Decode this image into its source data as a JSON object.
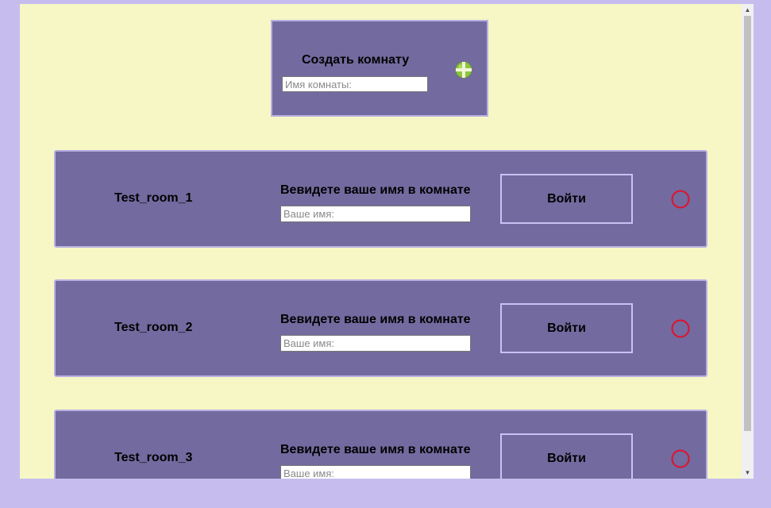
{
  "create_room": {
    "title": "Создать комнату",
    "input_placeholder": "Имя комнаты:",
    "input_value": "",
    "add_icon": "plus-circle-icon"
  },
  "rooms": [
    {
      "name": "Test_room_1",
      "prompt": "Вевидете ваше имя в комнате",
      "input_placeholder": "Ваше имя:",
      "input_value": "",
      "enter_label": "Войти",
      "status_icon": "empty-circle-icon"
    },
    {
      "name": "Test_room_2",
      "prompt": "Вевидете ваше имя в комнате",
      "input_placeholder": "Ваше имя:",
      "input_value": "",
      "enter_label": "Войти",
      "status_icon": "empty-circle-icon"
    },
    {
      "name": "Test_room_3",
      "prompt": "Вевидете ваше имя в комнате",
      "input_placeholder": "Ваше имя:",
      "input_value": "",
      "enter_label": "Войти",
      "status_icon": "empty-circle-icon"
    }
  ],
  "colors": {
    "page_background": "#c6bdee",
    "content_background": "#f6f7c4",
    "panel_background": "#736a9f",
    "panel_border": "#b8afe2",
    "add_icon_green": "#8cc63f",
    "status_ring_red": "#e0112b"
  }
}
